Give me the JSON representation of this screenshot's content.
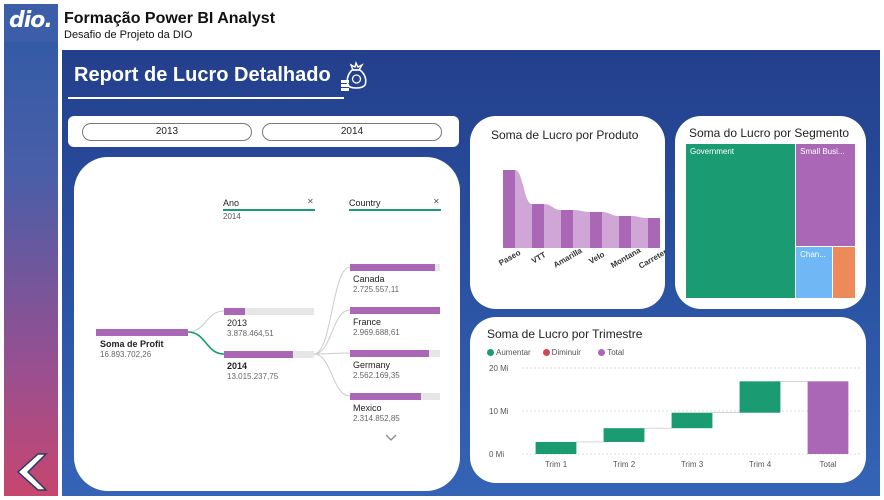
{
  "brand": {
    "logo_text": "dio."
  },
  "header": {
    "title": "Formação Power BI Analyst",
    "subtitle": "Desafio de Projeto da DIO"
  },
  "report": {
    "title": "Report de Lucro Detalhado"
  },
  "slicer": {
    "options": [
      "2013",
      "2014"
    ]
  },
  "decomposition": {
    "levels": [
      {
        "title": "Ano",
        "filter": "2014"
      },
      {
        "title": "Country",
        "filter": ""
      }
    ],
    "root": {
      "label": "Soma de Profit",
      "value": "16.893.702,26"
    },
    "years": [
      {
        "label": "2013",
        "value": "3.878.464,51",
        "share": 0.23
      },
      {
        "label": "2014",
        "value": "13.015.237,75",
        "share": 0.77
      }
    ],
    "countries": [
      {
        "label": "Canada",
        "value": "2.725.557,11",
        "share": 0.94
      },
      {
        "label": "France",
        "value": "2.969.688,61",
        "share": 1.0
      },
      {
        "label": "Germany",
        "value": "2.562.169,35",
        "share": 0.88
      },
      {
        "label": "Mexico",
        "value": "2.314.852,85",
        "share": 0.79
      }
    ],
    "close_icon": "close-icon",
    "more_icon": "chevron-down-icon"
  },
  "product_chart": {
    "title": "Soma de Lucro por Produto"
  },
  "segment_chart": {
    "title": "Soma do Lucro por Segmento"
  },
  "quarter_chart": {
    "title": "Soma de Lucro por Trimestre"
  },
  "chart_data": [
    {
      "type": "bar",
      "title": "Soma de Lucro por Produto",
      "categories": [
        "Paseo",
        "VTT",
        "Amarilla",
        "Velo",
        "Montana",
        "Carretera"
      ],
      "values": [
        3.9,
        2.2,
        1.9,
        1.8,
        1.6,
        1.5
      ],
      "color": "#a967b5"
    },
    {
      "type": "heatmap",
      "title": "Soma do Lucro por Segmento",
      "items": [
        {
          "label": "Government",
          "value": 11.4,
          "color": "#1a9b72"
        },
        {
          "label": "Small Busi...",
          "value": 4.1,
          "color": "#a967b5"
        },
        {
          "label": "Chan...",
          "value": 1.3,
          "color": "#6fb7f5"
        },
        {
          "label": "",
          "value": 0.8,
          "color": "#ec8a5a"
        }
      ]
    },
    {
      "type": "bar",
      "title": "Soma de Lucro por Trimestre",
      "categories": [
        "Trim 1",
        "Trim 2",
        "Trim 3",
        "Trim 4",
        "Total"
      ],
      "steps": [
        {
          "label": "Trim 1",
          "from": 0,
          "to": 2.8,
          "kind": "Aumentar"
        },
        {
          "label": "Trim 2",
          "from": 2.8,
          "to": 6.0,
          "kind": "Aumentar"
        },
        {
          "label": "Trim 3",
          "from": 6.0,
          "to": 9.6,
          "kind": "Aumentar"
        },
        {
          "label": "Trim 4",
          "from": 9.6,
          "to": 16.9,
          "kind": "Aumentar"
        },
        {
          "label": "Total",
          "from": 0,
          "to": 16.9,
          "kind": "Total"
        }
      ],
      "yticks": [
        "0 Mi",
        "10 Mi",
        "20 Mi"
      ],
      "ylim": [
        0,
        20
      ],
      "legend": [
        {
          "label": "Aumentar",
          "color": "#1a9b72"
        },
        {
          "label": "Diminuir",
          "color": "#d64550"
        },
        {
          "label": "Total",
          "color": "#a967b5"
        }
      ],
      "legend_position": "top-left"
    }
  ]
}
